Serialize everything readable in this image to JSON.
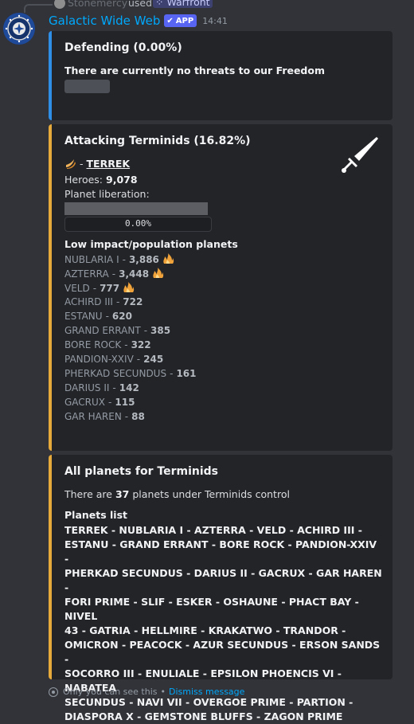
{
  "reply": {
    "user": "Stonemercy",
    "used": "used",
    "command": "Warfront"
  },
  "message": {
    "bot_name": "Galactic Wide Web",
    "app_tag": "APP",
    "time": "14:41"
  },
  "defending": {
    "title": "Defending (0.00%)",
    "text": "There are currently no threats to our Freedom"
  },
  "attacking": {
    "title": "Attacking Terminids (16.82%)",
    "planet_dash": "-",
    "planet": "TERREK",
    "heroes_label": "Heroes:",
    "heroes": "9,078",
    "liberation_label": "Planet liberation:",
    "liberation_pct": "0.00%",
    "liberation_fill": 0.0,
    "low_impact_title": "Low impact/population planets",
    "planets": [
      {
        "name": "NUBLARIA I",
        "value": "3,886",
        "fire": true
      },
      {
        "name": "AZTERRA",
        "value": "3,448",
        "fire": true
      },
      {
        "name": "VELD",
        "value": "777",
        "fire": true
      },
      {
        "name": "ACHIRD III",
        "value": "722",
        "fire": false
      },
      {
        "name": "ESTANU",
        "value": "620",
        "fire": false
      },
      {
        "name": "GRAND ERRANT",
        "value": "385",
        "fire": false
      },
      {
        "name": "BORE ROCK",
        "value": "322",
        "fire": false
      },
      {
        "name": "PANDION-XXIV",
        "value": "245",
        "fire": false
      },
      {
        "name": "PHERKAD SECUNDUS",
        "value": "161",
        "fire": false
      },
      {
        "name": "DARIUS II",
        "value": "142",
        "fire": false
      },
      {
        "name": "GACRUX",
        "value": "115",
        "fire": false
      },
      {
        "name": "GAR HAREN",
        "value": "88",
        "fire": false
      }
    ]
  },
  "all_planets": {
    "title": "All planets for Terminids",
    "count_prefix": "There are",
    "count": "37",
    "count_suffix": "planets under Terminids control",
    "list_title": "Planets list",
    "list_lines": [
      "TERREK - NUBLARIA I - AZTERRA - VELD - ACHIRD III -",
      "ESTANU - GRAND ERRANT - BORE ROCK - PANDION-XXIV -",
      "PHERKAD SECUNDUS - DARIUS II - GACRUX - GAR HAREN -",
      "FORI PRIME - SLIF - ESKER - OSHAUNE - PHACT BAY - NIVEL",
      "43 - GATRIA - HELLMIRE - KRAKATWO - TRANDOR -",
      "OMICRON - PEACOCK - AZUR SECUNDUS - ERSON SANDS -",
      "SOCORRO III - ENULIALE - EPSILON PHOENCIS VI - NABATEA",
      "SECUNDUS - NAVI VII - OVERGOE PRIME - PARTION -",
      "DIASPORA X - GEMSTONE BLUFFS - ZAGON PRIME"
    ]
  },
  "footer": {
    "text": "Only you can see this",
    "sep": "•",
    "dismiss": "Dismiss message"
  },
  "colors": {
    "background": "#313338",
    "embed_bg": "#232428",
    "defend_accent": "#2f8fe6",
    "attack_accent": "#e6a93b",
    "bot_name": "#00a8fc",
    "app_tag": "#5865f2"
  }
}
